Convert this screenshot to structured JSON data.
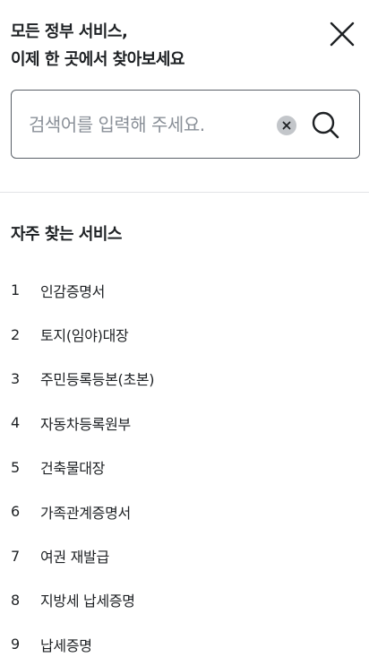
{
  "header": {
    "title_line1": "모든 정부 서비스,",
    "title_line2": "이제 한 곳에서 찾아보세요"
  },
  "icons": {
    "close": "close-icon",
    "clear": "clear-icon",
    "search": "search-icon"
  },
  "search": {
    "placeholder": "검색어를 입력해 주세요.",
    "value": ""
  },
  "popular": {
    "title": "자주 찾는 서비스",
    "items": [
      {
        "rank": "1",
        "label": "인감증명서"
      },
      {
        "rank": "2",
        "label": "토지(임야)대장"
      },
      {
        "rank": "3",
        "label": "주민등록등본(초본)"
      },
      {
        "rank": "4",
        "label": "자동차등록원부"
      },
      {
        "rank": "5",
        "label": "건축물대장"
      },
      {
        "rank": "6",
        "label": "가족관계증명서"
      },
      {
        "rank": "7",
        "label": "여권 재발급"
      },
      {
        "rank": "8",
        "label": "지방세 납세증명"
      },
      {
        "rank": "9",
        "label": "납세증명"
      }
    ]
  },
  "colors": {
    "text": "#1e2124",
    "border": "#5a6068",
    "placeholder": "#8a9098",
    "clear_bg": "#c3c6ca",
    "divider": "#e2e4e7"
  }
}
